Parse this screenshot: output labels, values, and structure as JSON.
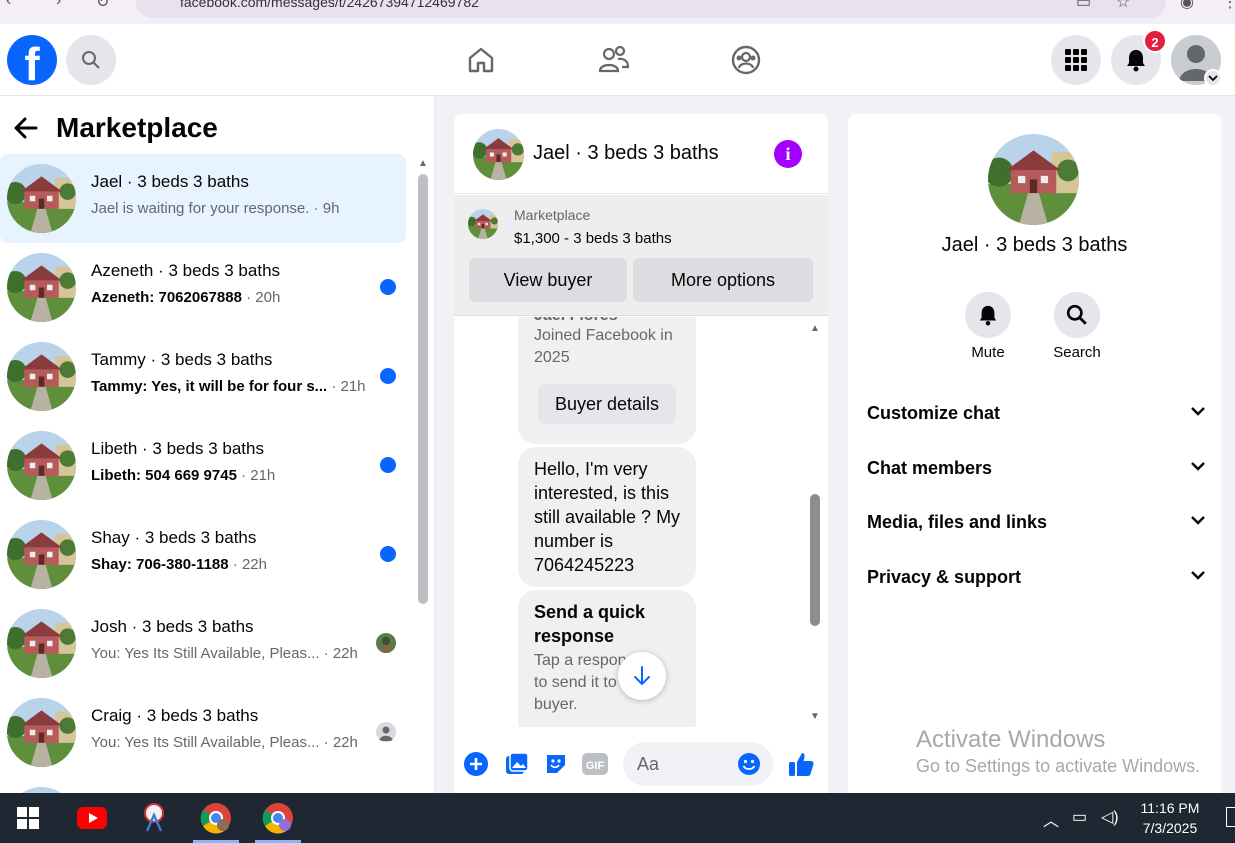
{
  "browser": {
    "url": "facebook.com/messages/t/24267394712469782"
  },
  "topbar": {
    "logo_letter": "f",
    "notification_count": "2"
  },
  "marketplace": {
    "title": "Marketplace",
    "conversations": [
      {
        "name": "Jael · 3 beds 3 baths",
        "preview": "Jael is waiting for your response.",
        "time": " · 9h",
        "unread": false,
        "active": true,
        "indicator": "none"
      },
      {
        "name": "Azeneth · 3 beds 3 baths",
        "preview": "Azeneth: 7062067888",
        "time": " · 20h",
        "unread": true,
        "active": false,
        "indicator": "dot"
      },
      {
        "name": "Tammy · 3 beds 3 baths",
        "preview": "Tammy: Yes, it will be for four s...",
        "time": " · 21h",
        "unread": true,
        "active": false,
        "indicator": "dot"
      },
      {
        "name": "Libeth · 3 beds 3 baths",
        "preview": "Libeth: 504 669 9745",
        "time": " · 21h",
        "unread": true,
        "active": false,
        "indicator": "dot"
      },
      {
        "name": "Shay · 3 beds 3 baths",
        "preview": "Shay: 706-380-1188",
        "time": " · 22h",
        "unread": true,
        "active": false,
        "indicator": "dot"
      },
      {
        "name": "Josh · 3 beds 3 baths",
        "preview": "You: Yes Its Still Available, Pleas...",
        "time": " · 22h",
        "unread": false,
        "active": false,
        "indicator": "seen-photo"
      },
      {
        "name": "Craig · 3 beds 3 baths",
        "preview": "You: Yes Its Still Available, Pleas...",
        "time": " · 22h",
        "unread": false,
        "active": false,
        "indicator": "seen-default"
      }
    ]
  },
  "chat": {
    "title": "Jael · 3 beds 3 baths",
    "listing": {
      "label": "Marketplace",
      "price_title": "$1,300 - 3 beds 3 baths",
      "view_buyer": "View buyer",
      "more_options": "More options"
    },
    "profile_card": {
      "name_partial": "Jael Flores",
      "joined": "Joined Facebook in 2025",
      "button": "Buyer details"
    },
    "message": "Hello, I'm very interested, is this still available ? My number is 7064245223",
    "quick_response": {
      "title": "Send a quick response",
      "text": "Tap a response to send it to the buyer."
    },
    "composer_placeholder": "Aa"
  },
  "details": {
    "name": "Jael · 3 beds 3 baths",
    "actions": [
      {
        "label": "Mute",
        "icon": "bell-icon"
      },
      {
        "label": "Search",
        "icon": "search-icon"
      }
    ],
    "sections": [
      "Customize chat",
      "Chat members",
      "Media, files and links",
      "Privacy & support"
    ]
  },
  "watermark": {
    "line1": "Activate Windows",
    "line2": "Go to Settings to activate Windows."
  },
  "taskbar": {
    "time": "11:16 PM",
    "date": "7/3/2025"
  },
  "colors": {
    "brand": "#0866ff",
    "unread_dot": "#0866ff",
    "info": "#a200ff",
    "badge": "#e41e3f"
  }
}
